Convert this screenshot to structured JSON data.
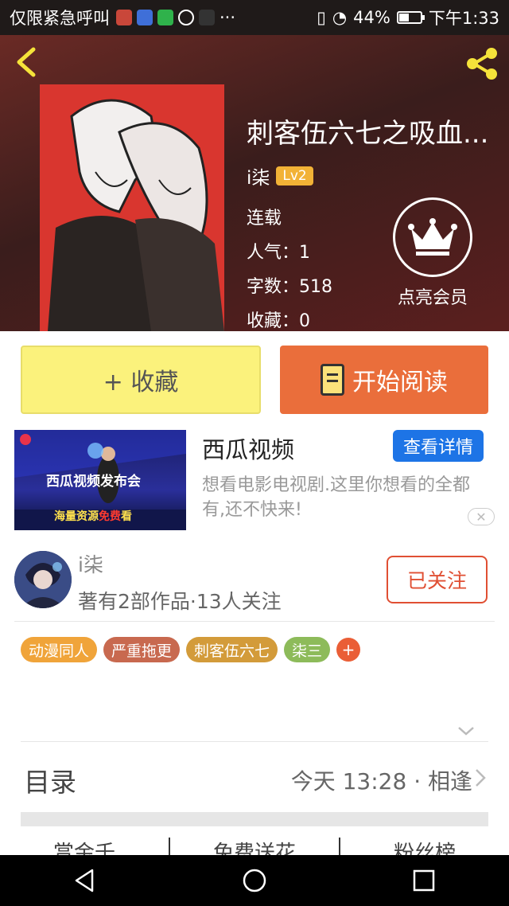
{
  "status_bar": {
    "carrier": "仅限紧急呼叫",
    "battery": "44%",
    "time": "下午1:33",
    "app_icons": [
      "shield-app-icon",
      "baidu-app-icon",
      "iqiyi-app-icon",
      "wechat-icon",
      "dashen-app-icon"
    ],
    "more": "···"
  },
  "book": {
    "title": "刺客伍六七之吸血...",
    "author": "i柒",
    "level": "Lv2",
    "status": "连载",
    "popularity": "人气：1",
    "word_count": "字数：518",
    "favorites": "收藏：0"
  },
  "vip": {
    "label": "点亮会员"
  },
  "actions": {
    "collect": "+ 收藏",
    "read": "开始阅读"
  },
  "ad": {
    "title": "西瓜视频",
    "detail_button": "查看详情",
    "description": "想看电影电视剧.这里你想看的全都有,还不快来!",
    "image_text_top": "西瓜视频发布会",
    "image_text_bottom_a": "海量资源",
    "image_text_bottom_b": "免费",
    "image_text_bottom_c": "看",
    "close": "✕"
  },
  "author_card": {
    "name": "i柒",
    "stats": "著有2部作品·13人关注",
    "follow_button": "已关注"
  },
  "tags": [
    {
      "label": "动漫同人",
      "color": "#f0a43a"
    },
    {
      "label": "严重拖更",
      "color": "#c8694f"
    },
    {
      "label": "刺客伍六七",
      "color": "#d39b3a"
    },
    {
      "label": "柒三",
      "color": "#8dbb5a"
    }
  ],
  "tag_add": "+",
  "toc": {
    "label": "目录",
    "latest": "今天 13:28 · 相逢"
  },
  "bottom_tabs": [
    "赏金千",
    "免费送花",
    "粉丝榜"
  ]
}
